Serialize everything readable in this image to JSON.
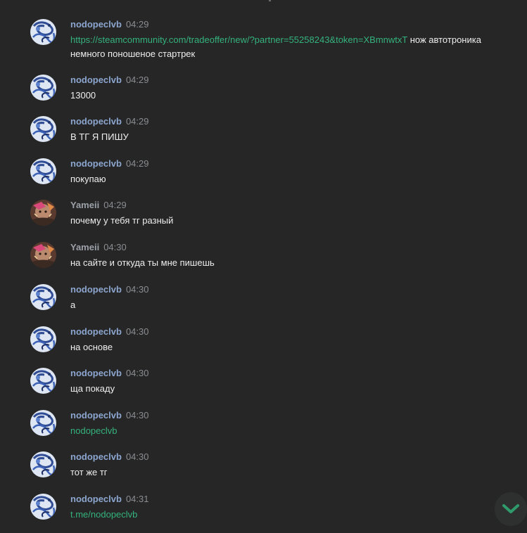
{
  "messages": [
    {
      "sender": "nodopeclvb",
      "time": "04:29",
      "link": "https://steamcommunity.com/tradeoffer/new/?partner=55258243&token=XBmnwtxT",
      "text": " нож автотроника немного поношеное стартрек"
    },
    {
      "sender": "nodopeclvb",
      "time": "04:29",
      "text": "13000"
    },
    {
      "sender": "nodopeclvb",
      "time": "04:29",
      "text": "В ТГ Я ПИШУ"
    },
    {
      "sender": "nodopeclvb",
      "time": "04:29",
      "text": "покупаю"
    },
    {
      "sender": "Yameii",
      "time": "04:29",
      "text": "почему у тебя тг разный"
    },
    {
      "sender": "Yameii",
      "time": "04:30",
      "text": "на сайте и откуда ты мне пишешь"
    },
    {
      "sender": "nodopeclvb",
      "time": "04:30",
      "text": "а"
    },
    {
      "sender": "nodopeclvb",
      "time": "04:30",
      "text": "на основе"
    },
    {
      "sender": "nodopeclvb",
      "time": "04:30",
      "text": "ща покаду"
    },
    {
      "sender": "nodopeclvb",
      "time": "04:30",
      "link": "nodopeclvb"
    },
    {
      "sender": "nodopeclvb",
      "time": "04:30",
      "text": "тот же тг"
    },
    {
      "sender": "nodopeclvb",
      "time": "04:31",
      "link": "t.me/nodopeclvb"
    }
  ],
  "icons": {
    "avatar_nodopeclvb": "swirl-avatar",
    "avatar_yameii": "photo-avatar",
    "scroll_down": "chevron-down-icon"
  },
  "colors": {
    "background": "#262626",
    "link": "#34b27d",
    "sender_name": "#8ca6cf",
    "scroll_button_icon": "#2f9a6b"
  }
}
